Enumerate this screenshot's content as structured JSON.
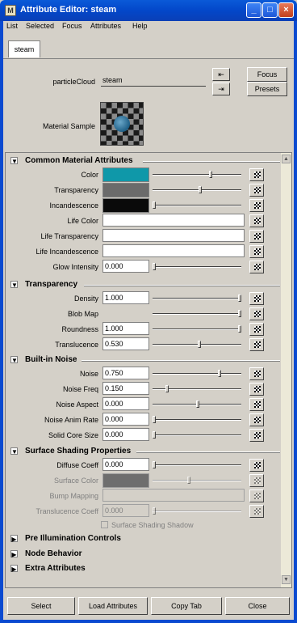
{
  "window": {
    "title": "Attribute Editor: steam"
  },
  "menus": [
    "List",
    "Selected",
    "Focus",
    "Attributes",
    "Help"
  ],
  "tabs": [
    "steam"
  ],
  "node": {
    "type_label": "particleCloud",
    "name": "steam"
  },
  "top_buttons": {
    "focus": "Focus",
    "presets": "Presets"
  },
  "material_sample_label": "Material Sample",
  "sections": {
    "common": "Common Material Attributes",
    "transparency": "Transparency",
    "noise": "Built-in Noise",
    "shading": "Surface Shading Properties",
    "preillum": "Pre Illumination Controls",
    "nodebehavior": "Node Behavior",
    "extra": "Extra Attributes"
  },
  "common": {
    "color_label": "Color",
    "transparency_label": "Transparency",
    "incandescence_label": "Incandescence",
    "life_color_label": "Life Color",
    "life_transparency_label": "Life Transparency",
    "life_incandescence_label": "Life Incandescence",
    "glow_label": "Glow Intensity",
    "glow_value": "0.000",
    "color_hex": "#0f98a9",
    "transparency_hex": "#6b6b6b",
    "incandescence_hex": "#0a0a0a"
  },
  "transparency": {
    "density_label": "Density",
    "density_value": "1.000",
    "blob_label": "Blob Map",
    "roundness_label": "Roundness",
    "roundness_value": "1.000",
    "translucence_label": "Translucence",
    "translucence_value": "0.530"
  },
  "noise": {
    "noise_label": "Noise",
    "noise_value": "0.750",
    "freq_label": "Noise Freq",
    "freq_value": "0.150",
    "aspect_label": "Noise Aspect",
    "aspect_value": "0.000",
    "anim_label": "Noise Anim Rate",
    "anim_value": "0.000",
    "core_label": "Solid Core Size",
    "core_value": "0.000"
  },
  "shading": {
    "diffuse_label": "Diffuse Coeff",
    "diffuse_value": "0.000",
    "surface_color_label": "Surface Color",
    "bump_label": "Bump Mapping",
    "transcoeff_label": "Translucence Coeff",
    "transcoeff_value": "0.000",
    "shadow_label": "Surface Shading Shadow"
  },
  "bottom_buttons": [
    "Select",
    "Load Attributes",
    "Copy Tab",
    "Close"
  ]
}
